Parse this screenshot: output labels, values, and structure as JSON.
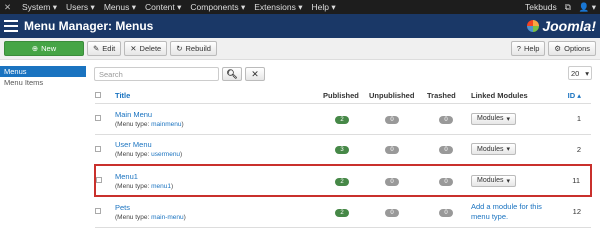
{
  "topbar": {
    "menu": [
      "System",
      "Users",
      "Menus",
      "Content",
      "Components",
      "Extensions",
      "Help"
    ],
    "user": "Tekbuds"
  },
  "titlebar": {
    "title": "Menu Manager: Menus",
    "brand": "Joomla!"
  },
  "toolbar": {
    "new_label": "New",
    "edit_label": "Edit",
    "delete_label": "Delete",
    "rebuild_label": "Rebuild",
    "help_label": "Help",
    "options_label": "Options"
  },
  "sidebar": {
    "items": [
      {
        "label": "Menus",
        "active": true
      },
      {
        "label": "Menu Items",
        "active": false
      }
    ]
  },
  "search": {
    "placeholder": "Search",
    "limit": "20"
  },
  "table": {
    "headers": {
      "title": "Title",
      "published": "Published",
      "unpublished": "Unpublished",
      "trashed": "Trashed",
      "linked": "Linked Modules",
      "id": "ID"
    },
    "rows": [
      {
        "title": "Main Menu",
        "type_label": "(Menu type:",
        "type": "mainmenu",
        "published": "2",
        "unpublished": "0",
        "trashed": "0",
        "modules": "Modules",
        "add_link": "",
        "id": "1"
      },
      {
        "title": "User Menu",
        "type_label": "(Menu type:",
        "type": "usermenu",
        "published": "3",
        "unpublished": "0",
        "trashed": "0",
        "modules": "Modules",
        "add_link": "",
        "id": "2"
      },
      {
        "title": "Menu1",
        "type_label": "(Menu type:",
        "type": "menu1",
        "published": "2",
        "unpublished": "0",
        "trashed": "0",
        "modules": "Modules",
        "add_link": "",
        "id": "11"
      },
      {
        "title": "Pets",
        "type_label": "(Menu type:",
        "type": "main-menu",
        "published": "2",
        "unpublished": "0",
        "trashed": "0",
        "modules": "",
        "add_link": "Add a module for this menu type.",
        "id": "12"
      }
    ]
  }
}
